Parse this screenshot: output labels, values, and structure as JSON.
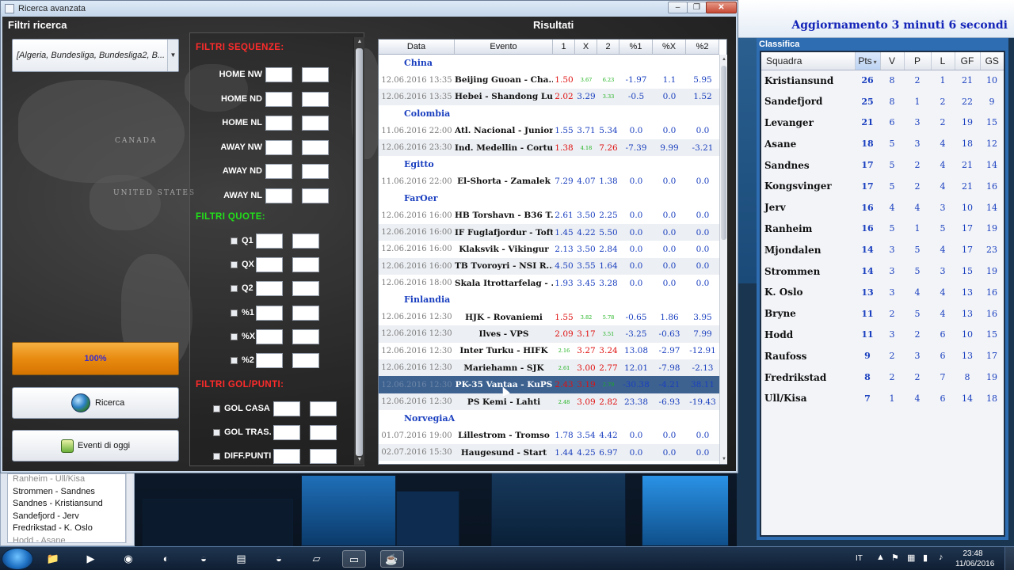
{
  "window": {
    "title": "Ricerca avanzata",
    "min": "–",
    "max": "❐",
    "close": "✕"
  },
  "left": {
    "filters_title": "Filtri ricerca",
    "league_select": "[Algeria, Bundesliga, Bundesliga2, B...",
    "map_labels": {
      "canada": "CANADA",
      "usa": "UNITED STATES"
    },
    "progress_label": "100%",
    "progress_value": 1.0,
    "search_button": "Ricerca",
    "today_button": "Eventi di oggi"
  },
  "filters": {
    "sequences_title": "FILTRI SEQUENZE:",
    "sequences": [
      "HOME NW",
      "HOME ND",
      "HOME NL",
      "AWAY NW",
      "AWAY ND",
      "AWAY NL"
    ],
    "odds_title": "FILTRI QUOTE:",
    "odds": [
      "Q1",
      "QX",
      "Q2",
      "%1",
      "%X",
      "%2"
    ],
    "goals_title": "FILTRI GOL/PUNTI:",
    "goals": [
      "GOL CASA",
      "GOL TRAS.",
      "DIFF.PUNTI"
    ]
  },
  "results": {
    "title": "Risultati",
    "columns": [
      "Data",
      "Evento",
      "1",
      "X",
      "2",
      "%1",
      "%X",
      "%2"
    ],
    "rows": [
      {
        "group": "China"
      },
      {
        "date": "12.06.2016 13:35",
        "event": "Beijing Guoan - Cha...",
        "o1": "1.50",
        "ox": "3.67",
        "o2": "6.23",
        "p1": "-1.97",
        "px": "1.1",
        "p2": "5.95",
        "c1": "red",
        "cx": "green",
        "c2": "green"
      },
      {
        "date": "12.06.2016 13:35",
        "event": "Hebei - Shandong Lu...",
        "o1": "2.02",
        "ox": "3.29",
        "o2": "3.33",
        "p1": "-0.5",
        "px": "0.0",
        "p2": "1.52",
        "c1": "red",
        "cx": "",
        "c2": "green"
      },
      {
        "group": "Colombia"
      },
      {
        "date": "11.06.2016 22:00",
        "event": "Atl. Nacional - Junior",
        "o1": "1.55",
        "ox": "3.71",
        "o2": "5.34",
        "p1": "0.0",
        "px": "0.0",
        "p2": "0.0",
        "c1": "",
        "cx": "",
        "c2": ""
      },
      {
        "date": "12.06.2016 23:30",
        "event": "Ind. Medellin - Cortu...",
        "o1": "1.38",
        "ox": "4.18",
        "o2": "7.26",
        "p1": "-7.39",
        "px": "9.99",
        "p2": "-3.21",
        "c1": "red",
        "cx": "green",
        "c2": "red"
      },
      {
        "group": "Egitto"
      },
      {
        "date": "11.06.2016 22:00",
        "event": "El-Shorta - Zamalek",
        "o1": "7.29",
        "ox": "4.07",
        "o2": "1.38",
        "p1": "0.0",
        "px": "0.0",
        "p2": "0.0",
        "c1": "",
        "cx": "",
        "c2": ""
      },
      {
        "group": "FarOer"
      },
      {
        "date": "12.06.2016 16:00",
        "event": "HB Torshavn - B36 T...",
        "o1": "2.61",
        "ox": "3.50",
        "o2": "2.25",
        "p1": "0.0",
        "px": "0.0",
        "p2": "0.0",
        "c1": "",
        "cx": "",
        "c2": ""
      },
      {
        "date": "12.06.2016 16:00",
        "event": "IF Fuglafjordur - Toftir",
        "o1": "1.45",
        "ox": "4.22",
        "o2": "5.50",
        "p1": "0.0",
        "px": "0.0",
        "p2": "0.0",
        "c1": "",
        "cx": "",
        "c2": ""
      },
      {
        "date": "12.06.2016 16:00",
        "event": "Klaksvik - Vikingur",
        "o1": "2.13",
        "ox": "3.50",
        "o2": "2.84",
        "p1": "0.0",
        "px": "0.0",
        "p2": "0.0",
        "c1": "",
        "cx": "",
        "c2": ""
      },
      {
        "date": "12.06.2016 16:00",
        "event": "TB Tvoroyri - NSI R...",
        "o1": "4.50",
        "ox": "3.55",
        "o2": "1.64",
        "p1": "0.0",
        "px": "0.0",
        "p2": "0.0",
        "c1": "",
        "cx": "",
        "c2": ""
      },
      {
        "date": "12.06.2016 18:00",
        "event": "Skala Itrottarfelag - ...",
        "o1": "1.93",
        "ox": "3.45",
        "o2": "3.28",
        "p1": "0.0",
        "px": "0.0",
        "p2": "0.0",
        "c1": "",
        "cx": "",
        "c2": ""
      },
      {
        "group": "Finlandia"
      },
      {
        "date": "12.06.2016 12:30",
        "event": "HJK - Rovaniemi",
        "o1": "1.55",
        "ox": "3.82",
        "o2": "5.78",
        "p1": "-0.65",
        "px": "1.86",
        "p2": "3.95",
        "c1": "red",
        "cx": "green",
        "c2": "green"
      },
      {
        "date": "12.06.2016 12:30",
        "event": "Ilves - VPS",
        "o1": "2.09",
        "ox": "3.17",
        "o2": "3.51",
        "p1": "-3.25",
        "px": "-0.63",
        "p2": "7.99",
        "c1": "red",
        "cx": "red",
        "c2": "green"
      },
      {
        "date": "12.06.2016 12:30",
        "event": "Inter Turku - HIFK",
        "o1": "2.16",
        "ox": "3.27",
        "o2": "3.24",
        "p1": "13.08",
        "px": "-2.97",
        "p2": "-12.91",
        "c1": "green",
        "cx": "red",
        "c2": "red"
      },
      {
        "date": "12.06.2016 12:30",
        "event": "Mariehamn - SJK",
        "o1": "2.61",
        "ox": "3.00",
        "o2": "2.77",
        "p1": "12.01",
        "px": "-7.98",
        "p2": "-2.13",
        "c1": "green",
        "cx": "red",
        "c2": "red"
      },
      {
        "date": "12.06.2016 12:30",
        "event": "PK-35 Vantaa - KuPS",
        "o1": "2.43",
        "ox": "3.19",
        "o2": "2.79",
        "p1": "-30.38",
        "px": "-4.21",
        "p2": "38.11",
        "c1": "red",
        "cx": "red",
        "c2": "green",
        "selected": true
      },
      {
        "date": "12.06.2016 12:30",
        "event": "PS Kemi - Lahti",
        "o1": "2.48",
        "ox": "3.09",
        "o2": "2.82",
        "p1": "23.38",
        "px": "-6.93",
        "p2": "-19.43",
        "c1": "green",
        "cx": "red",
        "c2": "red"
      },
      {
        "group": "NorvegiaA"
      },
      {
        "date": "01.07.2016 19:00",
        "event": "Lillestrom - Tromso",
        "o1": "1.78",
        "ox": "3.54",
        "o2": "4.42",
        "p1": "0.0",
        "px": "0.0",
        "p2": "0.0",
        "c1": "",
        "cx": "",
        "c2": ""
      },
      {
        "date": "02.07.2016 15:30",
        "event": "Haugesund - Start",
        "o1": "1.44",
        "ox": "4.25",
        "o2": "6.97",
        "p1": "0.0",
        "px": "0.0",
        "p2": "0.0",
        "c1": "",
        "cx": "",
        "c2": ""
      }
    ]
  },
  "standings": {
    "update_label": "Aggiornamento 3 minuti 6 secondi",
    "title": "Classifica",
    "columns": [
      "Squadra",
      "Pts",
      "V",
      "P",
      "L",
      "GF",
      "GS"
    ],
    "sorted_marker": "▾",
    "rows": [
      [
        "Kristiansund",
        "26",
        "8",
        "2",
        "1",
        "21",
        "10"
      ],
      [
        "Sandefjord",
        "25",
        "8",
        "1",
        "2",
        "22",
        "9"
      ],
      [
        "Levanger",
        "21",
        "6",
        "3",
        "2",
        "19",
        "15"
      ],
      [
        "Asane",
        "18",
        "5",
        "3",
        "4",
        "18",
        "12"
      ],
      [
        "Sandnes",
        "17",
        "5",
        "2",
        "4",
        "21",
        "14"
      ],
      [
        "Kongsvinger",
        "17",
        "5",
        "2",
        "4",
        "21",
        "16"
      ],
      [
        "Jerv",
        "16",
        "4",
        "4",
        "3",
        "10",
        "14"
      ],
      [
        "Ranheim",
        "16",
        "5",
        "1",
        "5",
        "17",
        "19"
      ],
      [
        "Mjondalen",
        "14",
        "3",
        "5",
        "4",
        "17",
        "23"
      ],
      [
        "Strommen",
        "14",
        "3",
        "5",
        "3",
        "15",
        "19"
      ],
      [
        "K. Oslo",
        "13",
        "3",
        "4",
        "4",
        "13",
        "16"
      ],
      [
        "Bryne",
        "11",
        "2",
        "5",
        "4",
        "13",
        "16"
      ],
      [
        "Hodd",
        "11",
        "3",
        "2",
        "6",
        "10",
        "15"
      ],
      [
        "Raufoss",
        "9",
        "2",
        "3",
        "6",
        "13",
        "17"
      ],
      [
        "Fredrikstad",
        "8",
        "2",
        "2",
        "7",
        "8",
        "19"
      ],
      [
        "Ull/Kisa",
        "7",
        "1",
        "4",
        "6",
        "14",
        "18"
      ]
    ]
  },
  "bg_list": {
    "items": [
      "Ranheim - Ull/Kisa",
      "Strommen - Sandnes",
      "Sandnes - Kristiansund",
      "Sandefjord - Jerv",
      "Fredrikstad - K. Oslo",
      "Hodd - Asane"
    ]
  },
  "taskbar": {
    "icons": [
      {
        "name": "explorer-folder-icon",
        "glyph": "📁",
        "active": false
      },
      {
        "name": "media-player-icon",
        "glyph": "▶",
        "active": false
      },
      {
        "name": "chrome-icon",
        "glyph": "◉",
        "active": false
      },
      {
        "name": "firefox-icon",
        "glyph": "◐",
        "active": false
      },
      {
        "name": "eclipse-icon",
        "glyph": "◒",
        "active": false
      },
      {
        "name": "document-icon",
        "glyph": "▤",
        "active": false
      },
      {
        "name": "eclipse-2-icon",
        "glyph": "◒",
        "active": false
      },
      {
        "name": "notes-icon",
        "glyph": "▱",
        "active": false
      },
      {
        "name": "window-icon",
        "glyph": "▭",
        "active": true
      },
      {
        "name": "java-icon",
        "glyph": "☕",
        "active": true
      }
    ],
    "lang": "IT",
    "time": "23:48",
    "date": "11/06/2016"
  },
  "colors": {
    "accent_blue": "#1a3fbf",
    "odd_red": "#e01010",
    "odd_green": "#17b017",
    "title_red": "#ff2b2b",
    "title_green": "#22e01a",
    "progress_orange": "#e88b10",
    "selected_row": "#3d6290"
  }
}
